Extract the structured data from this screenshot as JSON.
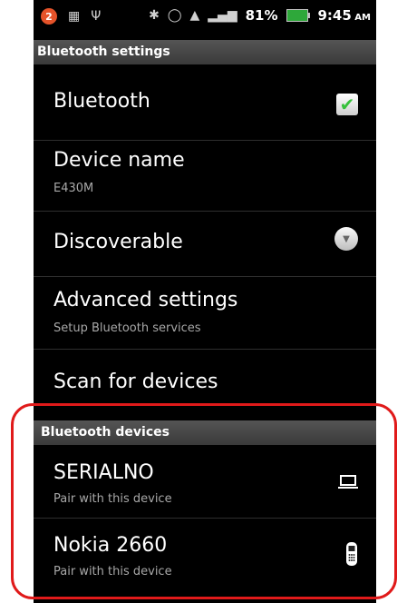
{
  "status_bar": {
    "notification_count": "2",
    "battery_percent": "81%",
    "time": "9:45",
    "ampm": "AM"
  },
  "title": "Bluetooth settings",
  "settings": [
    {
      "label": "Bluetooth",
      "control": "checkbox",
      "checked": true
    },
    {
      "label": "Device name",
      "summary": "E430M"
    },
    {
      "label": "Discoverable",
      "control": "dropdown"
    },
    {
      "label": "Advanced settings",
      "summary": "Setup Bluetooth services"
    },
    {
      "label": "Scan for devices"
    }
  ],
  "devices_section": {
    "header": "Bluetooth devices",
    "devices": [
      {
        "name": "SERIALNO",
        "summary": "Pair with this device",
        "icon": "laptop-icon"
      },
      {
        "name": "Nokia 2660",
        "summary": "Pair with this device",
        "icon": "phone-icon"
      }
    ]
  },
  "colors": {
    "highlight": "#e01a1a",
    "checkmark": "#36c13b",
    "battery": "#2ea83a"
  }
}
